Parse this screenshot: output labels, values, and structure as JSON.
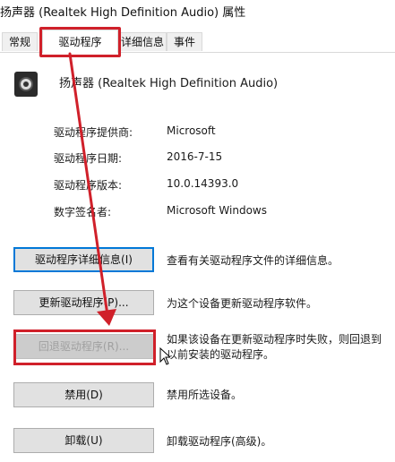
{
  "window": {
    "title": "扬声器 (Realtek High Definition Audio) 属性"
  },
  "tabs": [
    {
      "label": "常规"
    },
    {
      "label": "驱动程序"
    },
    {
      "label": "详细信息"
    },
    {
      "label": "事件"
    }
  ],
  "active_tab": "驱动程序",
  "device": {
    "icon": "speaker-icon",
    "name": "扬声器 (Realtek High Definition Audio)"
  },
  "driver_info": [
    {
      "label": "驱动程序提供商:",
      "value": "Microsoft"
    },
    {
      "label": "驱动程序日期:",
      "value": "2016-7-15"
    },
    {
      "label": "驱动程序版本:",
      "value": "10.0.14393.0"
    },
    {
      "label": "数字签名者:",
      "value": "Microsoft Windows"
    }
  ],
  "actions": [
    {
      "button": "驱动程序详细信息(I)",
      "description": "查看有关驱动程序文件的详细信息。",
      "enabled": true
    },
    {
      "button": "更新驱动程序(P)...",
      "description": "为这个设备更新驱动程序软件。",
      "enabled": true
    },
    {
      "button": "回退驱动程序(R)...",
      "description": "如果该设备在更新驱动程序时失败，则回退到以前安装的驱动程序。",
      "enabled": false
    },
    {
      "button": "禁用(D)",
      "description": "禁用所选设备。",
      "enabled": true
    },
    {
      "button": "卸载(U)",
      "description": "卸载驱动程序(高级)。",
      "enabled": true
    }
  ],
  "annotation_color": "#d0202a",
  "focus_color": "#0078d7"
}
